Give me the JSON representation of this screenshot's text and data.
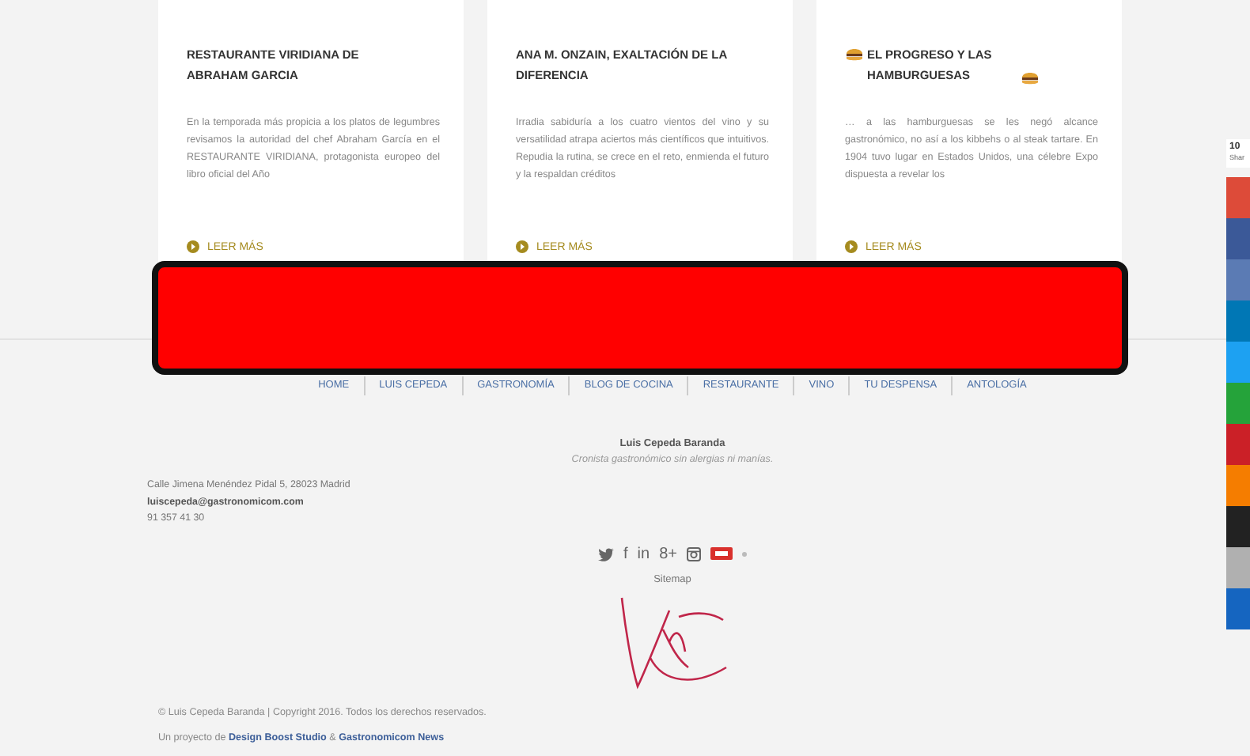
{
  "cards": [
    {
      "title": "RESTAURANTE VIRIDIANA DE ABRAHAM GARCIA",
      "burger": false,
      "excerpt": "En la temporada más propicia a los platos de legumbres revisamos la autoridad del chef Abraham García en el RESTAURANTE VIRIDIANA, protagonista europeo del libro oficial del Año",
      "link": "LEER MÁS"
    },
    {
      "title": "ANA M. ONZAIN, EXALTACIÓN DE LA DIFERENCIA",
      "burger": false,
      "excerpt": "Irradia sabiduría a los cuatro vientos del vino y su versatilidad atrapa aciertos más científicos que intuitivos. Repudia la rutina, se crece en el reto, enmienda el futuro y la respaldan créditos",
      "link": "LEER MÁS"
    },
    {
      "title": "EL PROGRESO Y LAS HAMBURGUESAS",
      "burger": true,
      "excerpt": "… a las hamburguesas se les negó alcance gastronómico, no así a los kibbehs o al steak tartare. En 1904 tuvo lugar en Estados Unidos, una célebre Expo dispuesta a revelar los",
      "link": "LEER MÁS"
    }
  ],
  "nav": [
    "HOME",
    "LUIS CEPEDA",
    "GASTRONOMÍA",
    "BLOG DE COCINA",
    "RESTAURANTE",
    "VINO",
    "TU DESPENSA",
    "ANTOLOGÍA"
  ],
  "author": {
    "name": "Luis Cepeda Baranda",
    "tagline": "Cronista gastronómico sin alergias ni manías."
  },
  "contact": {
    "address": "Calle Jimena Menéndez Pidal 5, 28023 Madrid",
    "email": "luiscepeda@gastronomicom.com",
    "phone": "91 357 41 30"
  },
  "social": [
    {
      "kind": "twitter"
    },
    {
      "kind": "glyph",
      "text": "f"
    },
    {
      "kind": "glyph",
      "text": "in"
    },
    {
      "kind": "glyph",
      "text": "8+"
    },
    {
      "kind": "instagram"
    },
    {
      "kind": "badge"
    },
    {
      "kind": "dot"
    }
  ],
  "sitemap": "Sitemap",
  "copyright": "© Luis Cepeda Baranda | Copyright 2016. Todos los derechos reservados.",
  "credits": {
    "prefix": "Un proyecto de",
    "first": "Design Boost Studio",
    "joiner": "&",
    "second": "Gastronomicom News"
  },
  "share_bar": {
    "count": "10",
    "label": "Shar",
    "buttons": [
      {
        "color": "#dd4b39"
      },
      {
        "color": "#3b5998"
      },
      {
        "color": "#5b7bb4"
      },
      {
        "color": "#0077b5"
      },
      {
        "color": "#1da1f2"
      },
      {
        "color": "#25a33a"
      },
      {
        "color": "#cb2027"
      },
      {
        "color": "#f57d00"
      },
      {
        "color": "#222222"
      },
      {
        "color": "#b0b0b0"
      },
      {
        "color": "#1565c0"
      }
    ]
  }
}
